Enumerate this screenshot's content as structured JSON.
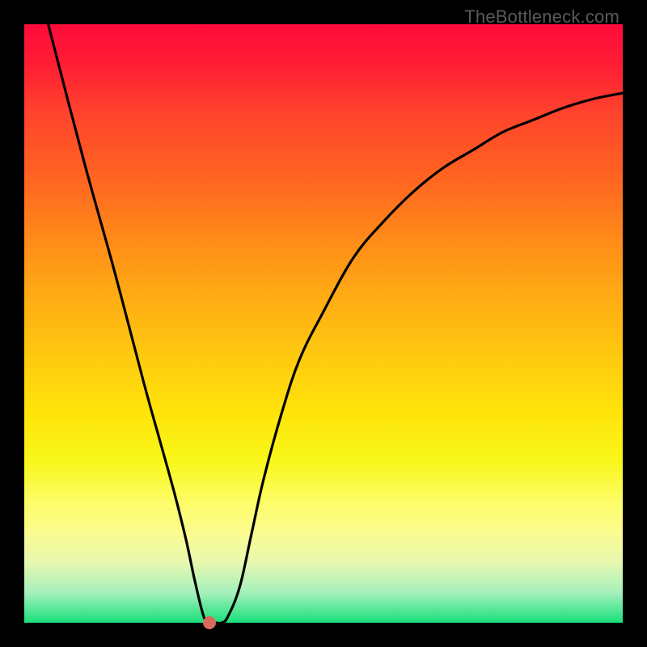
{
  "watermark": "TheBottleneck.com",
  "chart_data": {
    "type": "line",
    "title": "",
    "xlabel": "",
    "ylabel": "",
    "xlim": [
      0,
      100
    ],
    "ylim": [
      0,
      100
    ],
    "series": [
      {
        "name": "curve",
        "x": [
          4,
          10,
          15,
          20,
          22.5,
          25,
          27,
          28.5,
          30,
          31,
          32,
          33,
          34,
          36,
          38,
          40,
          43,
          46,
          50,
          55,
          60,
          65,
          70,
          75,
          80,
          85,
          90,
          95,
          100
        ],
        "y": [
          100,
          77,
          59,
          40,
          31,
          22,
          14,
          7,
          1,
          0,
          0,
          0,
          1,
          6,
          15,
          24,
          35,
          44,
          52,
          61,
          67,
          72,
          76,
          79,
          82,
          84,
          86,
          87.5,
          88.5
        ]
      }
    ],
    "marker": {
      "x": 31,
      "y": 0
    }
  },
  "colors": {
    "curve": "#000000",
    "marker": "#da695e",
    "canvas_border": "#000000"
  }
}
